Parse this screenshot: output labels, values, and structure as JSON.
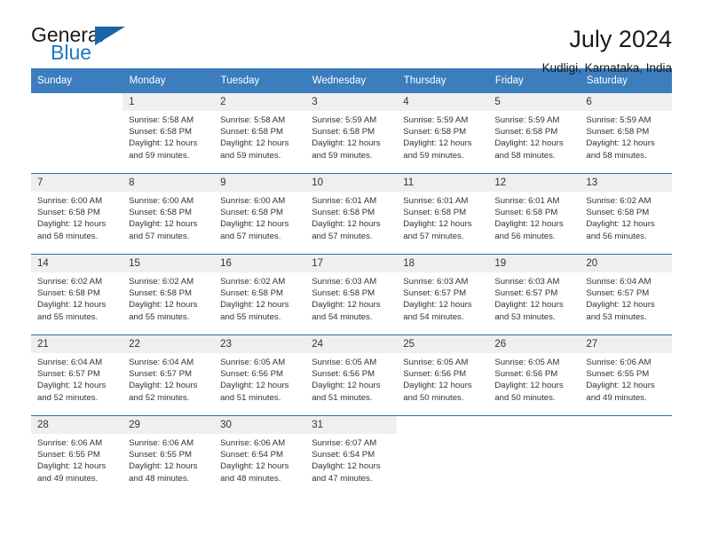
{
  "brand": {
    "name_top": "General",
    "name_bottom": "Blue",
    "triangle_color": "#1565a8",
    "blue_color": "#1f78c1"
  },
  "header": {
    "title": "July 2024",
    "subtitle": "Kudligi, Karnataka, India"
  },
  "theme": {
    "header_bg": "#3b7dbd",
    "header_text": "#ffffff",
    "daynum_bg": "#efefef",
    "week_divider": "#2f6da9",
    "body_text": "#333333"
  },
  "calendar": {
    "weekday_headers": [
      "Sunday",
      "Monday",
      "Tuesday",
      "Wednesday",
      "Thursday",
      "Friday",
      "Saturday"
    ],
    "weeks": [
      [
        {
          "day": "",
          "sunrise": "",
          "sunset": "",
          "daylight1": "",
          "daylight2": ""
        },
        {
          "day": "1",
          "sunrise": "Sunrise: 5:58 AM",
          "sunset": "Sunset: 6:58 PM",
          "daylight1": "Daylight: 12 hours",
          "daylight2": "and 59 minutes."
        },
        {
          "day": "2",
          "sunrise": "Sunrise: 5:58 AM",
          "sunset": "Sunset: 6:58 PM",
          "daylight1": "Daylight: 12 hours",
          "daylight2": "and 59 minutes."
        },
        {
          "day": "3",
          "sunrise": "Sunrise: 5:59 AM",
          "sunset": "Sunset: 6:58 PM",
          "daylight1": "Daylight: 12 hours",
          "daylight2": "and 59 minutes."
        },
        {
          "day": "4",
          "sunrise": "Sunrise: 5:59 AM",
          "sunset": "Sunset: 6:58 PM",
          "daylight1": "Daylight: 12 hours",
          "daylight2": "and 59 minutes."
        },
        {
          "day": "5",
          "sunrise": "Sunrise: 5:59 AM",
          "sunset": "Sunset: 6:58 PM",
          "daylight1": "Daylight: 12 hours",
          "daylight2": "and 58 minutes."
        },
        {
          "day": "6",
          "sunrise": "Sunrise: 5:59 AM",
          "sunset": "Sunset: 6:58 PM",
          "daylight1": "Daylight: 12 hours",
          "daylight2": "and 58 minutes."
        }
      ],
      [
        {
          "day": "7",
          "sunrise": "Sunrise: 6:00 AM",
          "sunset": "Sunset: 6:58 PM",
          "daylight1": "Daylight: 12 hours",
          "daylight2": "and 58 minutes."
        },
        {
          "day": "8",
          "sunrise": "Sunrise: 6:00 AM",
          "sunset": "Sunset: 6:58 PM",
          "daylight1": "Daylight: 12 hours",
          "daylight2": "and 57 minutes."
        },
        {
          "day": "9",
          "sunrise": "Sunrise: 6:00 AM",
          "sunset": "Sunset: 6:58 PM",
          "daylight1": "Daylight: 12 hours",
          "daylight2": "and 57 minutes."
        },
        {
          "day": "10",
          "sunrise": "Sunrise: 6:01 AM",
          "sunset": "Sunset: 6:58 PM",
          "daylight1": "Daylight: 12 hours",
          "daylight2": "and 57 minutes."
        },
        {
          "day": "11",
          "sunrise": "Sunrise: 6:01 AM",
          "sunset": "Sunset: 6:58 PM",
          "daylight1": "Daylight: 12 hours",
          "daylight2": "and 57 minutes."
        },
        {
          "day": "12",
          "sunrise": "Sunrise: 6:01 AM",
          "sunset": "Sunset: 6:58 PM",
          "daylight1": "Daylight: 12 hours",
          "daylight2": "and 56 minutes."
        },
        {
          "day": "13",
          "sunrise": "Sunrise: 6:02 AM",
          "sunset": "Sunset: 6:58 PM",
          "daylight1": "Daylight: 12 hours",
          "daylight2": "and 56 minutes."
        }
      ],
      [
        {
          "day": "14",
          "sunrise": "Sunrise: 6:02 AM",
          "sunset": "Sunset: 6:58 PM",
          "daylight1": "Daylight: 12 hours",
          "daylight2": "and 55 minutes."
        },
        {
          "day": "15",
          "sunrise": "Sunrise: 6:02 AM",
          "sunset": "Sunset: 6:58 PM",
          "daylight1": "Daylight: 12 hours",
          "daylight2": "and 55 minutes."
        },
        {
          "day": "16",
          "sunrise": "Sunrise: 6:02 AM",
          "sunset": "Sunset: 6:58 PM",
          "daylight1": "Daylight: 12 hours",
          "daylight2": "and 55 minutes."
        },
        {
          "day": "17",
          "sunrise": "Sunrise: 6:03 AM",
          "sunset": "Sunset: 6:58 PM",
          "daylight1": "Daylight: 12 hours",
          "daylight2": "and 54 minutes."
        },
        {
          "day": "18",
          "sunrise": "Sunrise: 6:03 AM",
          "sunset": "Sunset: 6:57 PM",
          "daylight1": "Daylight: 12 hours",
          "daylight2": "and 54 minutes."
        },
        {
          "day": "19",
          "sunrise": "Sunrise: 6:03 AM",
          "sunset": "Sunset: 6:57 PM",
          "daylight1": "Daylight: 12 hours",
          "daylight2": "and 53 minutes."
        },
        {
          "day": "20",
          "sunrise": "Sunrise: 6:04 AM",
          "sunset": "Sunset: 6:57 PM",
          "daylight1": "Daylight: 12 hours",
          "daylight2": "and 53 minutes."
        }
      ],
      [
        {
          "day": "21",
          "sunrise": "Sunrise: 6:04 AM",
          "sunset": "Sunset: 6:57 PM",
          "daylight1": "Daylight: 12 hours",
          "daylight2": "and 52 minutes."
        },
        {
          "day": "22",
          "sunrise": "Sunrise: 6:04 AM",
          "sunset": "Sunset: 6:57 PM",
          "daylight1": "Daylight: 12 hours",
          "daylight2": "and 52 minutes."
        },
        {
          "day": "23",
          "sunrise": "Sunrise: 6:05 AM",
          "sunset": "Sunset: 6:56 PM",
          "daylight1": "Daylight: 12 hours",
          "daylight2": "and 51 minutes."
        },
        {
          "day": "24",
          "sunrise": "Sunrise: 6:05 AM",
          "sunset": "Sunset: 6:56 PM",
          "daylight1": "Daylight: 12 hours",
          "daylight2": "and 51 minutes."
        },
        {
          "day": "25",
          "sunrise": "Sunrise: 6:05 AM",
          "sunset": "Sunset: 6:56 PM",
          "daylight1": "Daylight: 12 hours",
          "daylight2": "and 50 minutes."
        },
        {
          "day": "26",
          "sunrise": "Sunrise: 6:05 AM",
          "sunset": "Sunset: 6:56 PM",
          "daylight1": "Daylight: 12 hours",
          "daylight2": "and 50 minutes."
        },
        {
          "day": "27",
          "sunrise": "Sunrise: 6:06 AM",
          "sunset": "Sunset: 6:55 PM",
          "daylight1": "Daylight: 12 hours",
          "daylight2": "and 49 minutes."
        }
      ],
      [
        {
          "day": "28",
          "sunrise": "Sunrise: 6:06 AM",
          "sunset": "Sunset: 6:55 PM",
          "daylight1": "Daylight: 12 hours",
          "daylight2": "and 49 minutes."
        },
        {
          "day": "29",
          "sunrise": "Sunrise: 6:06 AM",
          "sunset": "Sunset: 6:55 PM",
          "daylight1": "Daylight: 12 hours",
          "daylight2": "and 48 minutes."
        },
        {
          "day": "30",
          "sunrise": "Sunrise: 6:06 AM",
          "sunset": "Sunset: 6:54 PM",
          "daylight1": "Daylight: 12 hours",
          "daylight2": "and 48 minutes."
        },
        {
          "day": "31",
          "sunrise": "Sunrise: 6:07 AM",
          "sunset": "Sunset: 6:54 PM",
          "daylight1": "Daylight: 12 hours",
          "daylight2": "and 47 minutes."
        },
        {
          "day": "",
          "sunrise": "",
          "sunset": "",
          "daylight1": "",
          "daylight2": ""
        },
        {
          "day": "",
          "sunrise": "",
          "sunset": "",
          "daylight1": "",
          "daylight2": ""
        },
        {
          "day": "",
          "sunrise": "",
          "sunset": "",
          "daylight1": "",
          "daylight2": ""
        }
      ]
    ]
  }
}
